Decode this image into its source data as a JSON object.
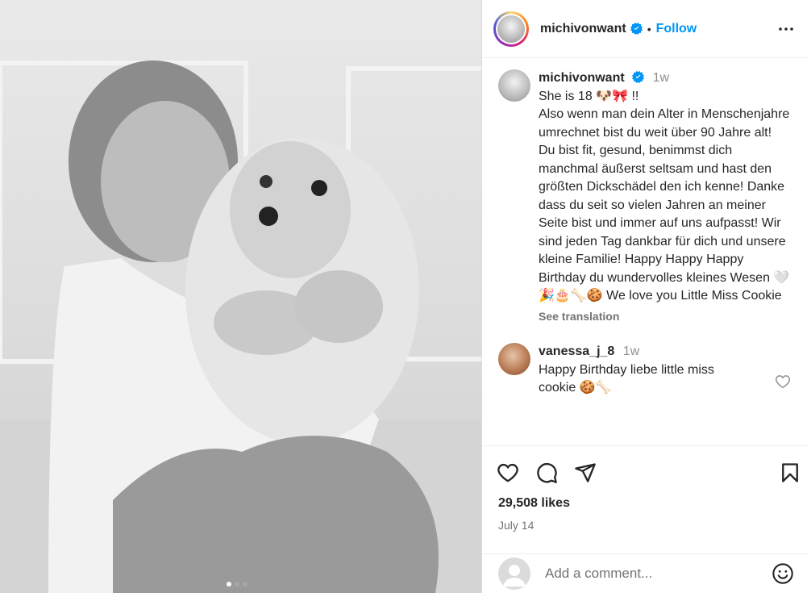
{
  "post": {
    "username": "michivonwant",
    "follow_label": "Follow",
    "separator": "•"
  },
  "caption": {
    "username": "michivonwant",
    "time": "1w",
    "text": "She is 18 🐶🎀 !!\nAlso wenn man dein Alter in Menschenjahre umrechnet bist du weit über 90 Jahre alt!\nDu bist fit, gesund, benimmst dich manchmal äußerst seltsam und hast den größten Dickschädel den ich kenne! Danke dass du seit so vielen Jahren an meiner Seite bist und immer auf uns aufpasst! Wir sind jeden Tag dankbar für dich und unsere kleine Familie! Happy Happy Happy Birthday du wundervolles kleines Wesen 🤍🎉🎂🦴🍪 We love you Little Miss Cookie",
    "see_translation": "See translation"
  },
  "comments": [
    {
      "username": "vanessa_j_8",
      "time": "1w",
      "text": "Happy Birthday liebe little miss cookie 🍪🦴"
    }
  ],
  "likes": "29,508 likes",
  "date": "July 14",
  "add_comment_placeholder": "Add a comment...",
  "carousel": {
    "count": 3,
    "active": 0
  },
  "icons": [
    "verified-icon",
    "more-icon",
    "heart-icon",
    "comment-icon",
    "share-icon",
    "bookmark-icon",
    "emoji-icon"
  ],
  "colors": {
    "accent": "#0095f6",
    "verified": "#0095f6",
    "text": "#262626",
    "muted": "#737373"
  }
}
